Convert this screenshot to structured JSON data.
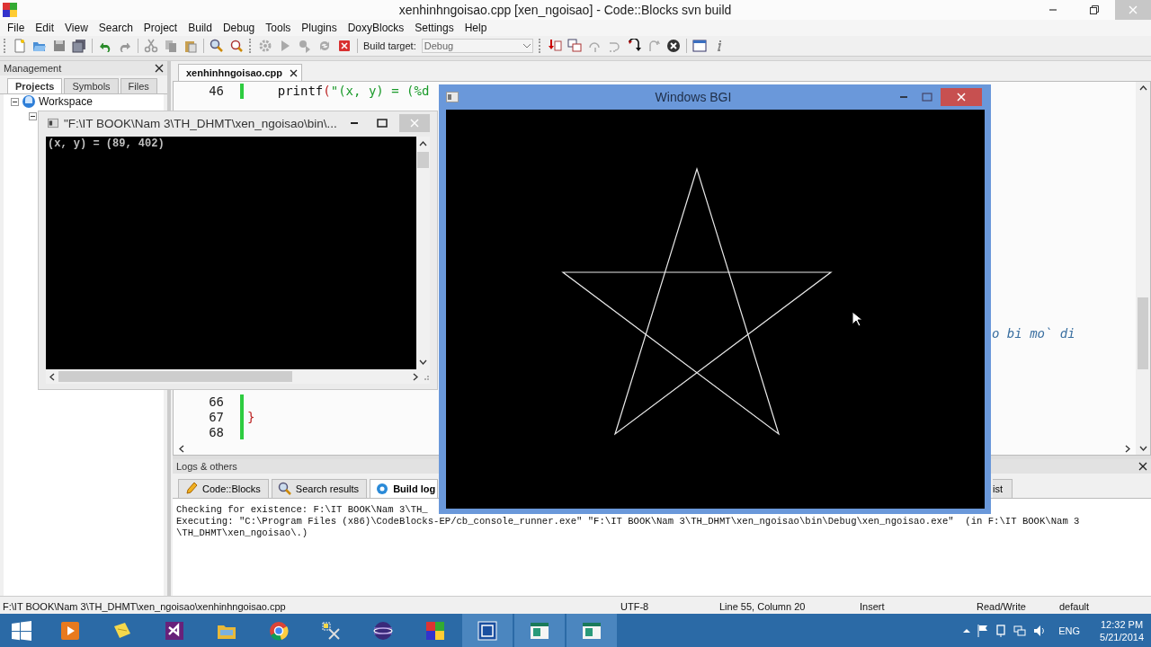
{
  "window": {
    "title": "xenhinhngoisao.cpp [xen_ngoisao] - Code::Blocks svn build"
  },
  "menu": [
    "File",
    "Edit",
    "View",
    "Search",
    "Project",
    "Build",
    "Debug",
    "Tools",
    "Plugins",
    "DoxyBlocks",
    "Settings",
    "Help"
  ],
  "toolbar": {
    "build_target_label": "Build target:",
    "build_target": "Debug"
  },
  "management": {
    "title": "Management",
    "tabs": [
      {
        "label": "Projects",
        "selected": true
      },
      {
        "label": "Symbols",
        "selected": false
      },
      {
        "label": "Files",
        "selected": false
      }
    ],
    "tree": [
      {
        "label": "Workspace",
        "expanded": true,
        "children": [
          {
            "expanded": true
          }
        ]
      }
    ]
  },
  "editor": {
    "tabs": [
      {
        "label": "xenhinhngoisao.cpp",
        "selected": true
      }
    ],
    "lines_top": [
      {
        "number": "46",
        "tokens": [
          {
            "kind": "plain",
            "text": "    printf"
          },
          {
            "kind": "operator",
            "text": "("
          },
          {
            "kind": "string",
            "text": "\"(x, y) = (%d"
          }
        ]
      }
    ],
    "comment_fragment": "o bi mo` di",
    "lines_bottom": [
      {
        "number": "66"
      },
      {
        "number": "67",
        "tokens": [
          {
            "kind": "operator",
            "text": "}"
          }
        ]
      },
      {
        "number": "68"
      }
    ]
  },
  "logs": {
    "title": "Logs & others",
    "tabs": [
      {
        "label": "Code::Blocks",
        "selected": false
      },
      {
        "label": "Search results",
        "selected": false
      },
      {
        "label": "Build log",
        "selected": true
      },
      {
        "label": "ist",
        "selected": false
      }
    ],
    "lines": [
      "Checking for existence: F:\\IT BOOK\\Nam 3\\TH_",
      "Executing: \"C:\\Program Files (x86)\\CodeBlocks-EP/cb_console_runner.exe\" \"F:\\IT BOOK\\Nam 3\\TH_DHMT\\xen_ngoisao\\bin\\Debug\\xen_ngoisao.exe\"  (in F:\\IT BOOK\\Nam 3",
      "\\TH_DHMT\\xen_ngoisao\\.)"
    ]
  },
  "status_bar": {
    "path": "F:\\IT BOOK\\Nam 3\\TH_DHMT\\xen_ngoisao\\xenhinhngoisao.cpp",
    "encoding": "UTF-8",
    "position": "Line 55, Column 20",
    "mode": "Insert",
    "access": "Read/Write",
    "profile": "default"
  },
  "console_window": {
    "title": "\"F:\\IT BOOK\\Nam 3\\TH_DHMT\\xen_ngoisao\\bin\\...",
    "output": [
      "(x, y) = (89, 402)"
    ]
  },
  "bgi_window": {
    "title": "Windows BGI"
  },
  "taskbar": {
    "language": "ENG",
    "time": "12:32 PM",
    "date": "5/21/2014"
  }
}
